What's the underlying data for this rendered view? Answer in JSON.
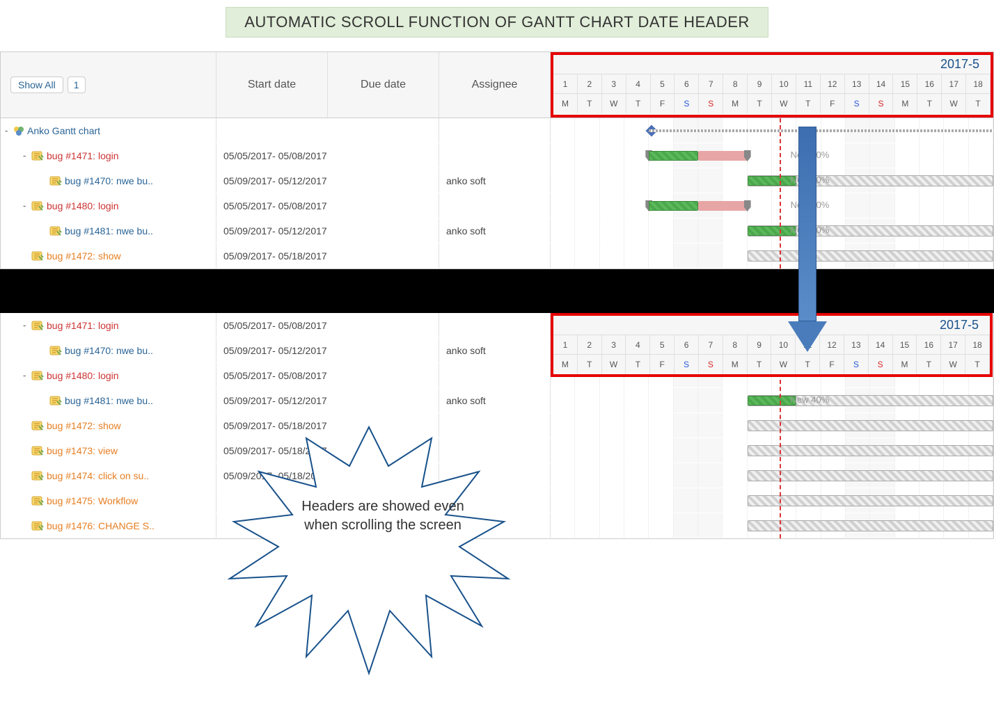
{
  "title": "AUTOMATIC SCROLL FUNCTION OF GANTT CHART DATE HEADER",
  "header": {
    "show_all": "Show All",
    "badge": "1",
    "start": "Start date",
    "due": "Due date",
    "assignee": "Assignee",
    "month": "2017-5",
    "days": [
      "1",
      "2",
      "3",
      "4",
      "5",
      "6",
      "7",
      "8",
      "9",
      "10",
      "11",
      "12",
      "13",
      "14",
      "15",
      "16",
      "17",
      "18"
    ],
    "dow": [
      "M",
      "T",
      "W",
      "T",
      "F",
      "S",
      "S",
      "M",
      "T",
      "W",
      "T",
      "F",
      "S",
      "S",
      "M",
      "T",
      "W",
      "T"
    ]
  },
  "callout": "Headers are showed even when scrolling the screen",
  "panel1": {
    "project": "Anko Gantt chart",
    "rows": [
      {
        "indent": 1,
        "toggle": "-",
        "icon": "issue",
        "cls": "link-red",
        "label": "bug #1471: login",
        "dates": "05/05/2017- 05/08/2017",
        "assignee": "",
        "bar": {
          "type": "caps",
          "from": 5,
          "to": 8,
          "green": [
            5,
            6
          ],
          "pink": [
            7,
            8
          ]
        },
        "label2": "New 40%"
      },
      {
        "indent": 2,
        "toggle": "",
        "icon": "issue",
        "cls": "link-blue",
        "label": "bug #1470: nwe bu..",
        "dates": "05/09/2017- 05/12/2017",
        "assignee": "anko soft",
        "bar": {
          "type": "hatch",
          "from": 9,
          "to": 18,
          "green": [
            9,
            10
          ]
        },
        "label2": "New 40%"
      },
      {
        "indent": 1,
        "toggle": "-",
        "icon": "issue",
        "cls": "link-red",
        "label": "bug #1480: login",
        "dates": "05/05/2017- 05/08/2017",
        "assignee": "",
        "bar": {
          "type": "caps",
          "from": 5,
          "to": 8,
          "green": [
            5,
            6
          ],
          "pink": [
            7,
            8
          ]
        },
        "label2": "New 40%"
      },
      {
        "indent": 2,
        "toggle": "",
        "icon": "issue",
        "cls": "link-blue",
        "label": "bug #1481: nwe bu..",
        "dates": "05/09/2017- 05/12/2017",
        "assignee": "anko soft",
        "bar": {
          "type": "hatch",
          "from": 9,
          "to": 18,
          "green": [
            9,
            10
          ]
        },
        "label2": "New 40%"
      },
      {
        "indent": 1,
        "toggle": "",
        "icon": "issue",
        "cls": "link-orange",
        "label": "bug #1472: show",
        "dates": "05/09/2017- 05/18/2017",
        "assignee": "",
        "bar": {
          "type": "hatch",
          "from": 9,
          "to": 18
        }
      }
    ]
  },
  "panel2": {
    "rows": [
      {
        "indent": 1,
        "toggle": "-",
        "icon": "issue",
        "cls": "link-red",
        "label": "bug #1471: login",
        "dates": "05/05/2017- 05/08/2017",
        "assignee": ""
      },
      {
        "indent": 2,
        "toggle": "",
        "icon": "issue",
        "cls": "link-blue",
        "label": "bug #1470: nwe bu..",
        "dates": "05/09/2017- 05/12/2017",
        "assignee": "anko soft"
      },
      {
        "indent": 1,
        "toggle": "-",
        "icon": "issue",
        "cls": "link-red",
        "label": "bug #1480: login",
        "dates": "05/05/2017- 05/08/2017",
        "assignee": ""
      },
      {
        "indent": 2,
        "toggle": "",
        "icon": "issue",
        "cls": "link-blue",
        "label": "bug #1481: nwe bu..",
        "dates": "05/09/2017- 05/12/2017",
        "assignee": "anko soft",
        "bar": {
          "type": "hatch",
          "from": 9,
          "to": 18,
          "green": [
            9,
            10
          ]
        },
        "label2": "New 40%"
      },
      {
        "indent": 1,
        "toggle": "",
        "icon": "issue",
        "cls": "link-orange",
        "label": "bug #1472: show",
        "dates": "05/09/2017- 05/18/2017",
        "assignee": "",
        "bar": {
          "type": "hatch",
          "from": 9,
          "to": 18
        }
      },
      {
        "indent": 1,
        "toggle": "",
        "icon": "issue",
        "cls": "link-orange",
        "label": "bug #1473: view",
        "dates": "05/09/2017- 05/18/2017",
        "assignee": "",
        "bar": {
          "type": "hatch",
          "from": 9,
          "to": 18
        }
      },
      {
        "indent": 1,
        "toggle": "",
        "icon": "issue",
        "cls": "link-orange",
        "label": "bug #1474: click on su..",
        "dates": "05/09/2017- 05/18/2017",
        "assignee": "",
        "bar": {
          "type": "hatch",
          "from": 9,
          "to": 18
        }
      },
      {
        "indent": 1,
        "toggle": "",
        "icon": "issue",
        "cls": "link-orange",
        "label": "bug #1475: Workflow",
        "dates": "",
        "assignee": "",
        "bar": {
          "type": "hatch",
          "from": 9,
          "to": 18
        }
      },
      {
        "indent": 1,
        "toggle": "",
        "icon": "issue",
        "cls": "link-orange",
        "label": "bug #1476: CHANGE S..",
        "dates": "",
        "assignee": "",
        "bar": {
          "type": "hatch",
          "from": 9,
          "to": 18
        }
      }
    ]
  }
}
